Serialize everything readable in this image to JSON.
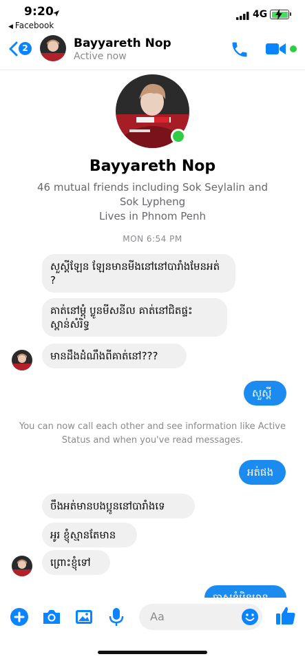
{
  "status_bar": {
    "time": "9:20",
    "back_app": "Facebook",
    "network": "4G"
  },
  "header": {
    "back_count": "2",
    "contact_name": "Bayyareth Nop",
    "contact_status": "Active now"
  },
  "profile": {
    "name": "Bayyareth Nop",
    "mutual_friends": "46 mutual friends including Sok Seylalin and Sok Lypheng",
    "lives_in": "Lives in Phnom Penh"
  },
  "conversation": {
    "timestamp": "MON 6:54 PM",
    "messages": [
      {
        "side": "in",
        "text": "សួស្ដីឡែន ឡែនមានមីងនៅនៅបារាំងមែនអត់ ?"
      },
      {
        "side": "in",
        "text": "គាត់នៅម្ដុំ ប្លូនមីសនីល គាត់នៅជិតផ្ទះស្ពាន់សំរិទ្ធ"
      },
      {
        "side": "in",
        "text": "មានដឹងដំណឹងពីគាត់នៅ???"
      },
      {
        "side": "out",
        "text": "សួស្ដី"
      },
      {
        "side": "out",
        "text": "អត់ផង"
      },
      {
        "side": "in",
        "text": "ចឹងអត់មានបងប្អូននៅបារាំងទេ"
      },
      {
        "side": "in",
        "text": "អូរ ខ្ញុំស្មានតែមាន"
      },
      {
        "side": "in",
        "text": "ព្រោះខ្ញុំទៅ"
      },
      {
        "side": "out",
        "text": "ចាសខ្ញុំមិនមាន"
      }
    ],
    "notice": "You can now call each other and see information like Active Status and when you've read messages."
  },
  "composer": {
    "placeholder": "Aa"
  },
  "colors": {
    "accent": "#0a84ff",
    "bubble_out": "#1b8bef",
    "bubble_in": "#f0f0f0",
    "online": "#31cc46"
  },
  "icons": [
    "location-arrow-icon",
    "signal-icon",
    "battery-icon",
    "back-chevron-icon",
    "phone-icon",
    "video-camera-icon",
    "plus-icon",
    "camera-icon",
    "gallery-icon",
    "microphone-icon",
    "emoji-icon",
    "thumbs-up-icon"
  ]
}
